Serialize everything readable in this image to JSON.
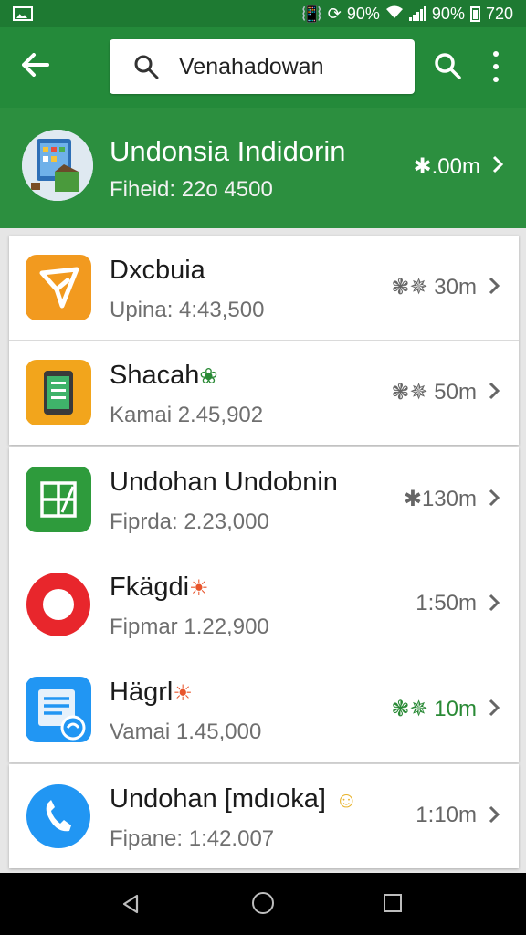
{
  "status_bar": {
    "vibrate_icon": "vibrate-icon",
    "sync_icon": "sync-icon",
    "battery_pct_1": "90%",
    "battery_pct_2": "90%",
    "time": "720"
  },
  "toolbar": {
    "search_value": "Venahadowan"
  },
  "featured": {
    "title": "Undonsia Indidorin",
    "subtitle": "Fiheid: 22o 4500",
    "meta": "✱.00m"
  },
  "apps": [
    {
      "name": "Dxcbuia",
      "detail": "Upina: 4:43,500",
      "meta": "❃✵ 30m",
      "badge": ""
    },
    {
      "name": "Shacah",
      "detail": "Kamai 2.45,902",
      "meta": "❃✵ 50m",
      "badge": "❀"
    },
    {
      "name": "Undohan Undobnin",
      "detail": "Fiprda: 2.23,000",
      "meta": "✱130m",
      "badge": ""
    },
    {
      "name": "Fkägdi",
      "detail": "Fipmar 1.22,900",
      "meta": "1:50m",
      "badge": "☀"
    },
    {
      "name": "Hägrl",
      "detail": "Vamai 1.45,000",
      "meta": "❃✵ 10m",
      "badge": "☀"
    },
    {
      "name": "Undohan [mdıoka]",
      "detail": "Fipane: 1:42.007",
      "meta": "1:10m",
      "badge": "☺"
    }
  ],
  "colors": {
    "toolbar": "#248a3a",
    "featured": "#2c8f3f",
    "accent_green": "#2a8a36"
  }
}
